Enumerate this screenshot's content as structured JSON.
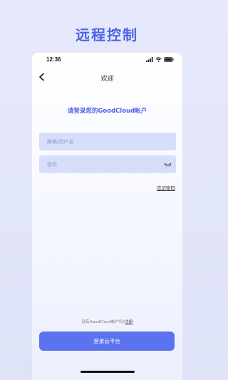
{
  "headline": "远程控制",
  "status_bar": {
    "time": "12:36",
    "icons": [
      "signal-icon",
      "wifi-icon",
      "battery-icon"
    ]
  },
  "nav": {
    "back_icon": "chevron-left-icon",
    "title": "欢迎"
  },
  "login": {
    "subtitle": "请登录您的GoodCloud帐户",
    "username_placeholder": "邮箱/用户名",
    "username_value": "",
    "password_placeholder": "密码",
    "password_value": "",
    "password_toggle_icon": "eye-off-icon",
    "forgot_password": "忘记密码",
    "register_prompt": "没有GoodCloud帐户吗?",
    "register_link": "注册",
    "submit_label": "登录云平台"
  },
  "colors": {
    "accent": "#4e63e8",
    "button": "#5b73ef",
    "field_bg": "#d6def9"
  }
}
